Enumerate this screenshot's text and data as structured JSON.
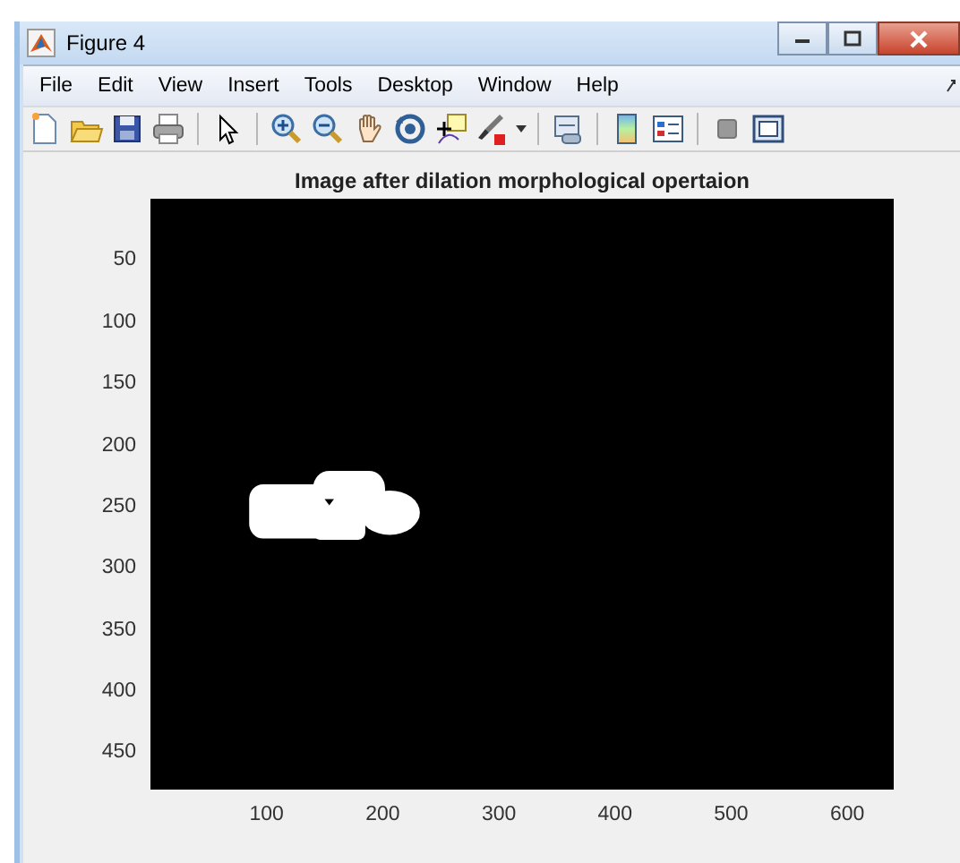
{
  "window": {
    "title": "Figure 4"
  },
  "menu": [
    "File",
    "Edit",
    "View",
    "Insert",
    "Tools",
    "Desktop",
    "Window",
    "Help"
  ],
  "axes": {
    "title": "Image after dilation morphological opertaion",
    "y_ticks": [
      "50",
      "100",
      "150",
      "200",
      "250",
      "300",
      "350",
      "400",
      "450"
    ],
    "x_ticks": [
      "100",
      "200",
      "300",
      "400",
      "500",
      "600"
    ]
  }
}
